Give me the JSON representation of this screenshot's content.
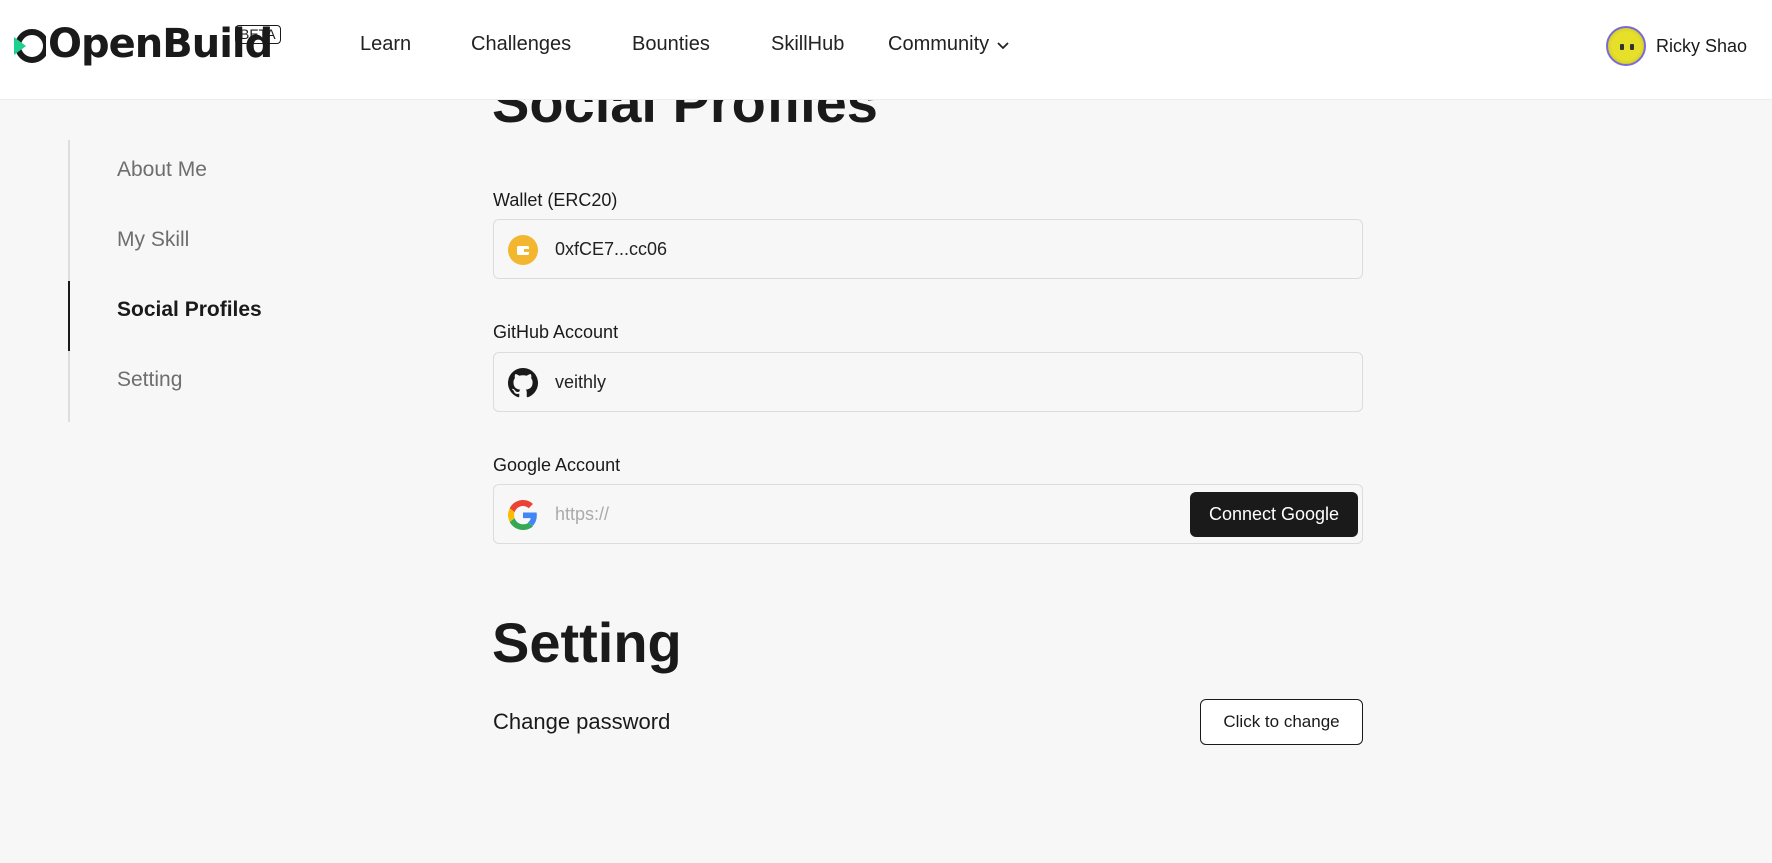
{
  "brand": {
    "name": "OpenBuild",
    "badge": "BETA",
    "accent": "#1fd18f"
  },
  "nav": {
    "items": [
      {
        "label": "Learn"
      },
      {
        "label": "Challenges"
      },
      {
        "label": "Bounties"
      },
      {
        "label": "SkillHub"
      },
      {
        "label": "Community",
        "icon": "chevron-down-icon"
      }
    ]
  },
  "user": {
    "name": "Ricky Shao",
    "avatar_colors": [
      "#e6e02a",
      "#7a6ad8"
    ]
  },
  "sidebar": {
    "items": [
      {
        "label": "About Me",
        "active": false
      },
      {
        "label": "My Skill",
        "active": false
      },
      {
        "label": "Social Profiles",
        "active": true
      },
      {
        "label": "Setting",
        "active": false
      }
    ]
  },
  "social": {
    "title": "Social Profiles",
    "wallet": {
      "label": "Wallet (ERC20)",
      "value": "0xfCE7...cc06",
      "icon": "wallet-icon"
    },
    "github": {
      "label": "GitHub Account",
      "value": "veithly",
      "icon": "github-icon"
    },
    "google": {
      "label": "Google Account",
      "placeholder": "https://",
      "icon": "google-icon",
      "button": "Connect Google"
    }
  },
  "setting": {
    "title": "Setting",
    "change_password_label": "Change password",
    "change_button": "Click to change"
  }
}
